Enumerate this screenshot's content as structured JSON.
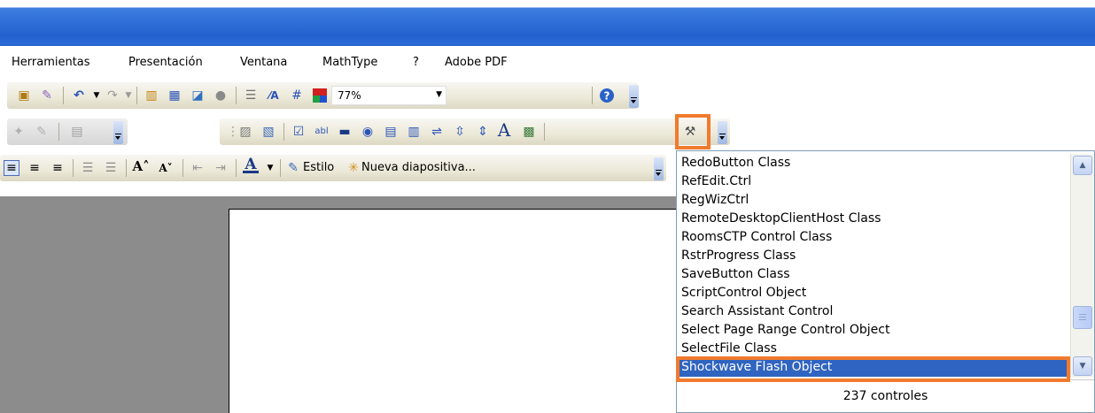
{
  "menubar": {
    "items": [
      "Herramientas",
      "Presentación",
      "Ventana",
      "MathType",
      "?",
      "Adobe PDF"
    ]
  },
  "toolbar1": {
    "zoom_value": "77%",
    "icons": [
      "paste-icon",
      "format-painter-icon",
      "undo-icon",
      "redo-icon",
      "insert-chart-icon",
      "insert-table-icon",
      "tables-borders-icon",
      "insert-hyperlink-icon",
      "expand-all-icon",
      "show-formatting-icon",
      "grid-icon",
      "color-grayscale-icon",
      "help-icon"
    ]
  },
  "toolbar2": {
    "icons": [
      "draw-icon",
      "pencil-icon",
      "insert-picture-icon",
      "properties-icon",
      "view-code-icon",
      "checkbox-control-icon",
      "textbox-control-icon",
      "command-button-icon",
      "option-button-icon",
      "listbox-icon",
      "combobox-icon",
      "toggle-button-icon",
      "spin-button-icon",
      "scrollbar-control-icon",
      "label-control-icon",
      "image-control-icon",
      "more-controls-icon"
    ]
  },
  "toolbar3": {
    "style_label": "Estilo",
    "new_slide_label": "Nueva diapositiva...",
    "font_color_letter": "A"
  },
  "controls_list": {
    "items": [
      "RedoButton Class",
      "RefEdit.Ctrl",
      "RegWizCtrl",
      "RemoteDesktopClientHost Class",
      "RoomsCTP Control Class",
      "RstrProgress Class",
      "SaveButton Class",
      "ScriptControl Object",
      "Search Assistant Control",
      "Select Page Range Control Object",
      "SelectFile Class",
      "Shockwave Flash Object"
    ],
    "selected_index": 11,
    "footer": "237 controles"
  },
  "colors": {
    "highlight": "#f07a2e",
    "selection": "#2f64c0",
    "titlebar": "#2461cf"
  }
}
